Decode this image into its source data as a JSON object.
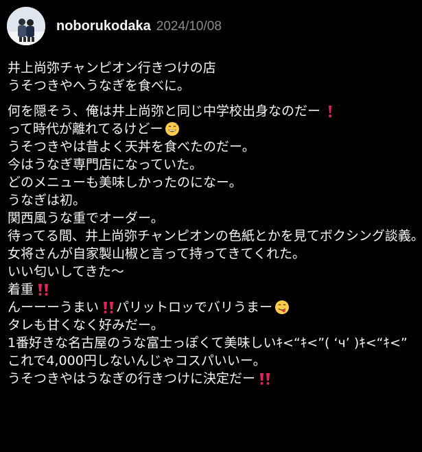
{
  "post": {
    "username": "noborukodaka",
    "date": "2024/10/08",
    "paragraph1": [
      "井上尚弥チャンピオン行きつけの店",
      "うそつきやへうなぎを食べに。"
    ],
    "paragraph2": [
      {
        "text": "何を隠そう、俺は井上尚弥と同じ中学校出身なのだー",
        "emoji": "exclamation-icon"
      },
      {
        "text": "って時代が離れてるけどー",
        "emoji": "grinning-sweat-icon"
      },
      {
        "text": "うそつきやは昔よく天丼を食べたのだー。"
      },
      {
        "text": "今はうなぎ専門店になっていた。"
      },
      {
        "text": "どのメニューも美味しかったのになー。"
      },
      {
        "text": "うなぎは初。"
      },
      {
        "text": "関西風うな重でオーダー。"
      },
      {
        "text": "待ってる間、井上尚弥チャンピオンの色紙とかを見てボクシング談義。"
      },
      {
        "text": "女将さんが自家製山椒と言って持ってきてくれた。"
      },
      {
        "text": "いい匂いしてきた〜"
      },
      {
        "text": "着重",
        "emoji": "double-exclamation-icon"
      },
      {
        "text": "んーーーうまい",
        "emoji": "double-exclamation-icon",
        "after": " パリットロッでバリうまー",
        "emoji2": "yum-face-icon"
      },
      {
        "text": "タレも甘くなく好みだー。"
      },
      {
        "text": "1番好きな名古屋のうな富士っぽくて美味しいｷ<“ｷ<”( ‘ч’ )ｷ<“ｷ<”"
      },
      {
        "text": "これで4,000円しないんじゃコスパいいー。"
      },
      {
        "text": "うそつきやはうなぎの行きつけに決定だー",
        "emoji": "double-exclamation-icon"
      }
    ]
  },
  "colors": {
    "background": "#000000",
    "text": "#f3f5f7",
    "muted": "#8c8c8c",
    "accent_red": "#e0245e"
  }
}
